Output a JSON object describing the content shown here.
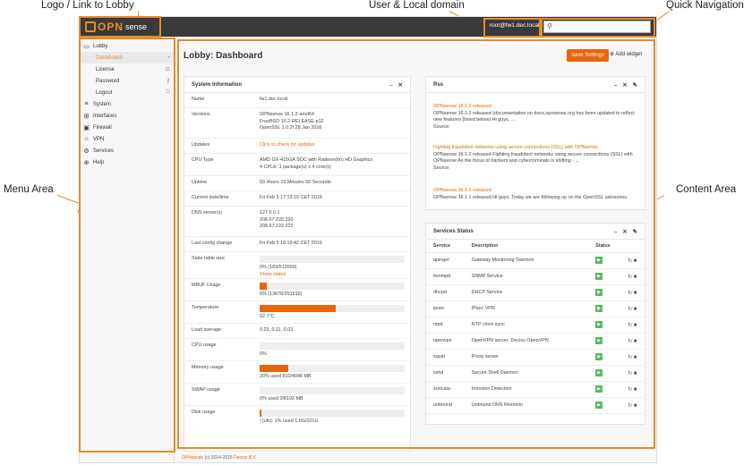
{
  "callouts": {
    "logo": "Logo / Link to Lobby",
    "user": "User & Local domain",
    "quick": "Quick Navigation",
    "menu": "Menu Area",
    "content": "Content Area"
  },
  "topbar": {
    "logo_text": "OPN",
    "logo_suffix": "sense",
    "user": "root@fw1.dec.local",
    "search_placeholder": ""
  },
  "sidebar": {
    "lobby": "Lobby",
    "sub": [
      {
        "label": "Dashboard",
        "icon": "dashboard-icon",
        "glyph": "◔"
      },
      {
        "label": "License",
        "icon": "license-icon",
        "glyph": "⚖"
      },
      {
        "label": "Password",
        "icon": "key-icon",
        "glyph": "⚷"
      },
      {
        "label": "Logout",
        "icon": "logout-icon",
        "glyph": "⎋"
      }
    ],
    "items": [
      {
        "label": "System",
        "glyph": "≡"
      },
      {
        "label": "Interfaces",
        "glyph": "⊞"
      },
      {
        "label": "Firewall",
        "glyph": "▣"
      },
      {
        "label": "VPN",
        "glyph": "⌂"
      },
      {
        "label": "Services",
        "glyph": "⚙"
      },
      {
        "label": "Help",
        "glyph": "⊕"
      }
    ]
  },
  "main": {
    "title": "Lobby: Dashboard",
    "save_label": "Save Settings",
    "add_widget": "Add widget"
  },
  "sysinfo": {
    "title": "System Information",
    "rows": {
      "name_k": "Name",
      "name_v": "fw1.dec.local",
      "ver_k": "Versions",
      "ver_v1": "OPNsense 16.1.2-amd64",
      "ver_v2": "FreeBSD 10.2-RELEASE-p12",
      "ver_v3": "OpenSSL 1.0.2f 28 Jan 2016",
      "upd_k": "Updates",
      "upd_v": "Click to check for updates",
      "cpu_k": "CPU Type",
      "cpu_v1": "AMD GX-415GA SOC with Radeon(tm) HD Graphics",
      "cpu_v2": "4 CPUs: 1 package(s) x 4 core(s)",
      "up_k": "Uptime",
      "up_v": "03 Hours 23 Minutes 56 Seconds",
      "dt_k": "Current date/time",
      "dt_v": "Fri Feb 5 17:13:15 CET 2016",
      "dns_k": "DNS server(s)",
      "dns_v1": "127.0.0.1",
      "dns_v2": "208.67.220.220",
      "dns_v3": "208.67.222.222",
      "lc_k": "Last config change",
      "lc_v": "Fri Feb 5 16:19:42 CET 2016",
      "st_k": "State table size",
      "st_v": "0% (183/512000)",
      "st_link": "Show states",
      "mbuf_k": "MBUF Usage",
      "mbuf_v": "5% (13676/251516)",
      "temp_k": "Temperature",
      "temp_v": "52.7°C",
      "la_k": "Load average",
      "la_v": "0.23, 0.11, 0.03",
      "cpuu_k": "CPU usage",
      "cpuu_v": "0%",
      "mem_k": "Memory usage",
      "mem_v": "20% used 810/4048 MB",
      "swap_k": "SWAP usage",
      "swap_v": "0% used 0/8192 MB",
      "disk_k": "Disk usage",
      "disk_v": "/ (ufs): 1% used 1.0G/101G"
    },
    "levels": {
      "state": 0.0,
      "mbuf": 0.05,
      "temp": 0.527,
      "cpu": 0.0,
      "mem": 0.2,
      "swap": 0.0,
      "disk": 0.01
    }
  },
  "rss": {
    "title": "Rss",
    "items": [
      {
        "t": "OPNsense 16.1.2 released",
        "b": "OPNsense 16.1.2 released   (documentation on docs.opnsense.org has been updated to reflect new features (listed below)   Hi guys, ...",
        "s": "Source:"
      },
      {
        "t": "Fighting fraudulent networks using secure connections (SSL) with OPNsense",
        "b": "OPNsense 16.1.2 released   Fighting fraudulent networks using secure connections (SSL) with OPNsense As the focus of hackers and cybercriminals is shifting - ...",
        "s": "Source:"
      },
      {
        "t": "OPNsense 16.1.1 released",
        "b": "OPNsense 16.1.1 released   Hi guys, Today we are following up on the OpenSSL advisories.",
        "s": ""
      }
    ]
  },
  "services": {
    "title": "Services Status",
    "headers": [
      "Service",
      "Description",
      "Status"
    ],
    "rows": [
      [
        "apinger",
        "Gateway Monitoring Daemon"
      ],
      [
        "bsnmpd",
        "SNMP Service"
      ],
      [
        "dhcpd",
        "DHCP Service"
      ],
      [
        "ipsec",
        "IPsec VPN"
      ],
      [
        "ntpd",
        "NTP clock sync"
      ],
      [
        "openvpn",
        "OpenVPN server: Deciso OpenVPN"
      ],
      [
        "squid",
        "Proxy server"
      ],
      [
        "sshd",
        "Secure Shell Daemon"
      ],
      [
        "suricata",
        "Intrusion Detection"
      ],
      [
        "unbound",
        "Unbound DNS Resolver"
      ]
    ]
  },
  "footer": {
    "brand": "OPNsense",
    "text": " (c) 2014-2016 ",
    "company": "Deciso B.V."
  }
}
